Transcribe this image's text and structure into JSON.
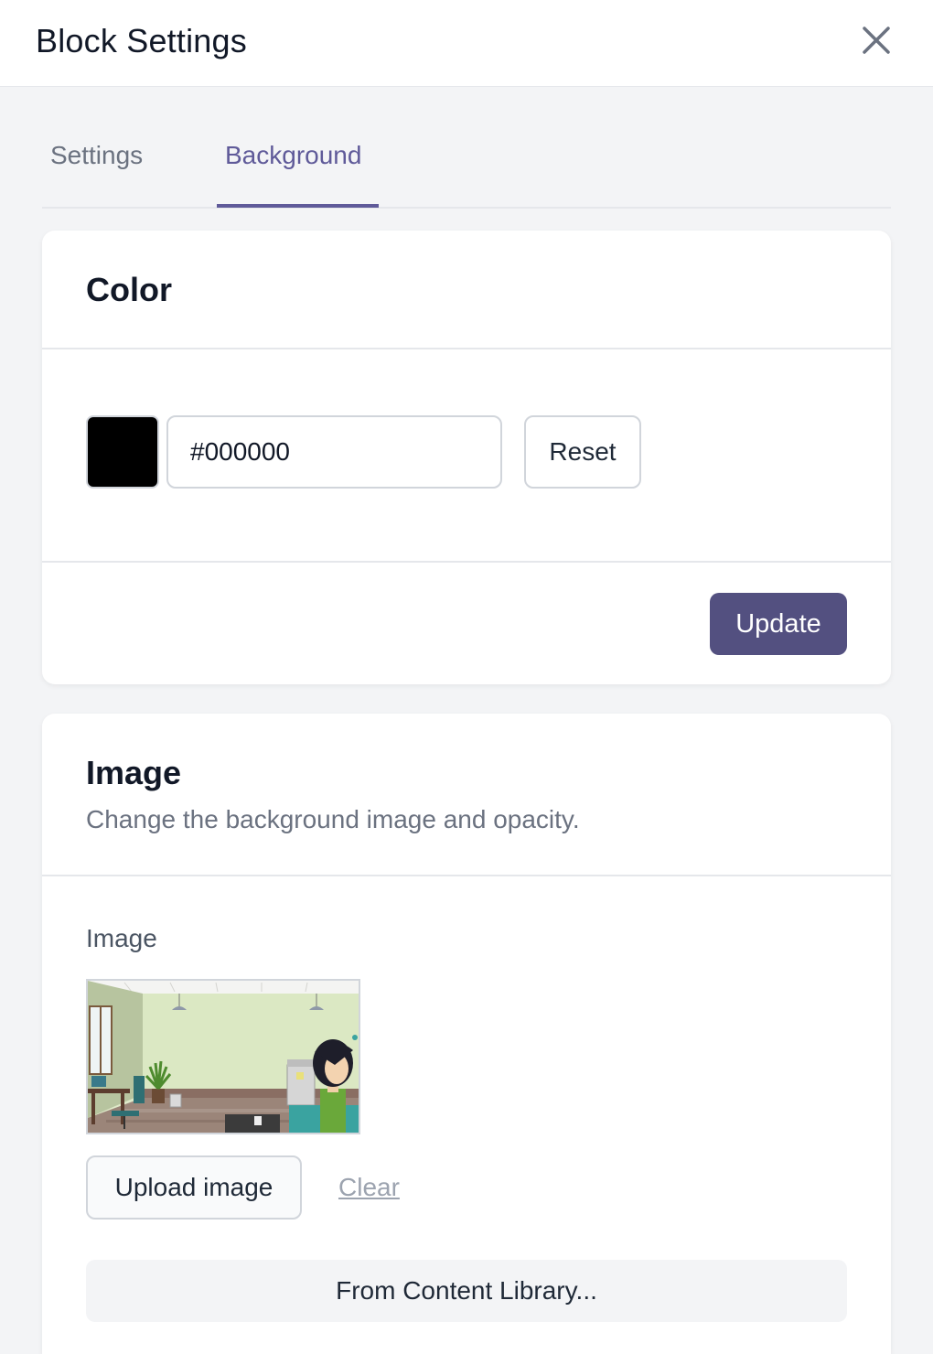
{
  "header": {
    "title": "Block Settings",
    "close_icon": "close-icon"
  },
  "tabs": [
    {
      "label": "Settings",
      "active": false
    },
    {
      "label": "Background",
      "active": true
    }
  ],
  "color_card": {
    "title": "Color",
    "swatch_color": "#000000",
    "hex_value": "#000000",
    "reset_label": "Reset",
    "update_label": "Update"
  },
  "image_card": {
    "title": "Image",
    "subtitle": "Change the background image and opacity.",
    "field_label": "Image",
    "upload_label": "Upload image",
    "clear_label": "Clear",
    "library_label": "From Content Library..."
  },
  "colors": {
    "accent": "#5f5a99",
    "primary_button": "#535080",
    "page_background": "#f3f4f6"
  }
}
